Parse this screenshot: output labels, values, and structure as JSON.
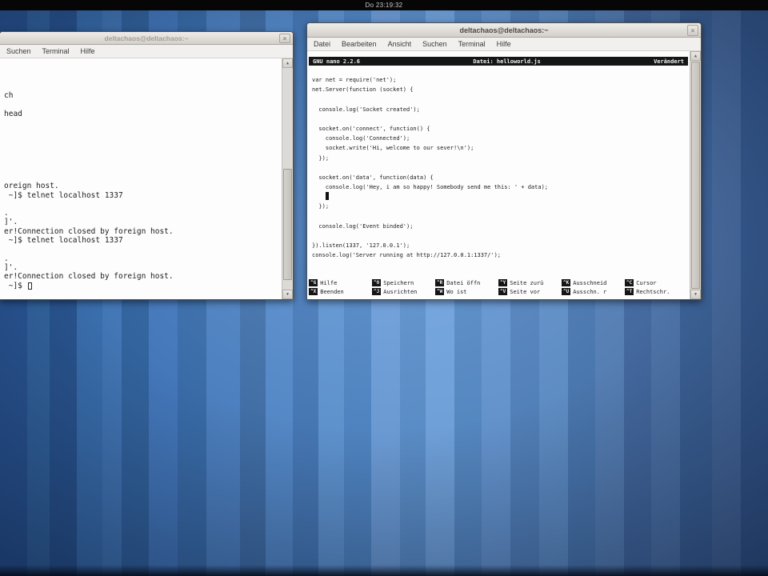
{
  "top_bar": {
    "clock": "Do 23:19:32"
  },
  "icons": {
    "close": "×",
    "scroll_up": "▲",
    "scroll_down": "▼"
  },
  "colors": {
    "wallpaper_blue": "#4d80bf",
    "titlebar_gray": "#d3cfca",
    "nano_bar_black": "#151515",
    "terminal_bg": "#fdfdfd"
  },
  "left_window": {
    "title": "deltachaos@deltachaos:~",
    "menu": [
      "Suchen",
      "Terminal",
      "Hilfe"
    ],
    "lines": [
      "",
      "ch",
      "",
      "head",
      "",
      "",
      "",
      "",
      "",
      "",
      "",
      "oreign host.",
      " ~]$ telnet localhost 1337",
      "",
      ".",
      "]'.",
      "er!Connection closed by foreign host.",
      " ~]$ telnet localhost 1337",
      "",
      ".",
      "]'.",
      "er!Connection closed by foreign host."
    ],
    "prompt": " ~]$ "
  },
  "right_window": {
    "title": "deltachaos@deltachaos:~",
    "menu": [
      "Datei",
      "Bearbeiten",
      "Ansicht",
      "Suchen",
      "Terminal",
      "Hilfe"
    ],
    "nano": {
      "version": "GNU nano 2.2.6",
      "file_label": "Datei: helloworld.js",
      "modified_label": "Verändert",
      "code_lines": [
        "var net = require('net');",
        "net.Server(function (socket) {",
        "",
        "  console.log('Socket created');",
        "",
        "  socket.on('connect', function() {",
        "    console.log('Connected');",
        "    socket.write('Hi, welcome to our sever!\\n');",
        "  });",
        "",
        "  socket.on('data', function(data) {",
        "    console.log('Hey, i am so happy! Somebody send me this: ' + data);",
        "    ",
        "  });",
        "",
        "  console.log('Event binded');",
        "",
        "}).listen(1337, '127.0.0.1');",
        "console.log('Server running at http://127.0.0.1:1337/');"
      ],
      "cursor": {
        "line": 12,
        "col": 4
      },
      "shortcuts_row1": [
        {
          "key": "^G",
          "label": "Hilfe"
        },
        {
          "key": "^O",
          "label": "Speichern"
        },
        {
          "key": "^R",
          "label": "Datei öffn"
        },
        {
          "key": "^Y",
          "label": "Seite zurü"
        },
        {
          "key": "^K",
          "label": "Ausschneid"
        },
        {
          "key": "^C",
          "label": "Cursor"
        }
      ],
      "shortcuts_row2": [
        {
          "key": "^X",
          "label": "Beenden"
        },
        {
          "key": "^J",
          "label": "Ausrichten"
        },
        {
          "key": "^W",
          "label": "Wo ist"
        },
        {
          "key": "^V",
          "label": "Seite vor"
        },
        {
          "key": "^U",
          "label": "Ausschn. r"
        },
        {
          "key": "^T",
          "label": "Rechtschr."
        }
      ]
    }
  }
}
